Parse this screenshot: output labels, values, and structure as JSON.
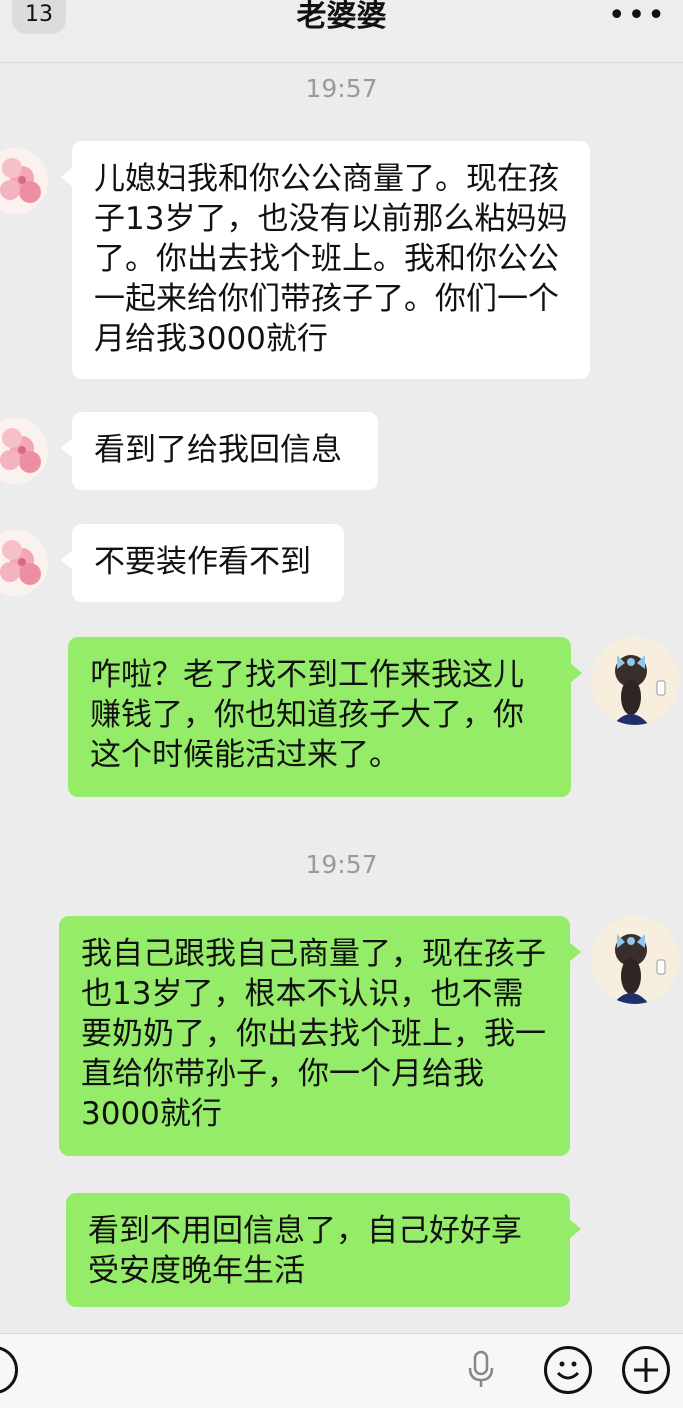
{
  "header": {
    "unread_count": "13",
    "title": "老婆婆",
    "more_label": "•••"
  },
  "timestamps": [
    "19:57",
    "19:57"
  ],
  "messages": [
    {
      "side": "in",
      "text": "  儿媳妇我和你公公商量了。现在孩子13岁了，也没有以前那么粘妈妈了。你出去找个班上。我和你公公一起来给你们带孩子了。你们一个月给我3000就行"
    },
    {
      "side": "in",
      "text": "看到了给我回信息"
    },
    {
      "side": "in",
      "text": "不要装作看不到"
    },
    {
      "side": "out",
      "text": "咋啦？老了找不到工作来我这儿赚钱了，你也知道孩子大了，你这个时候能活过来了。"
    },
    {
      "side": "out",
      "text": "我自己跟我自己商量了，现在孩子也13岁了，根本不认识，也不需要奶奶了，你出去找个班上，我一直给你带孙子，你一个月给我3000就行"
    },
    {
      "side": "out",
      "text": "看到不用回信息了，自己好好享受安度晚年生活"
    }
  ],
  "avatars": {
    "contact": "flower-avatar",
    "self": "girl-avatar"
  },
  "colors": {
    "background": "#ececec",
    "incoming_bubble": "#ffffff",
    "outgoing_bubble": "#95ec69",
    "timestamp_text": "#9a9a9a"
  }
}
